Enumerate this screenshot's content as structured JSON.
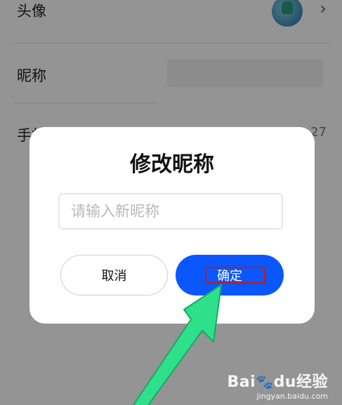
{
  "profile": {
    "rows": [
      {
        "label": "头像"
      },
      {
        "label": "昵称"
      },
      {
        "label": "手机号"
      }
    ],
    "phone_tail": "27",
    "chevron": "chevron-right-icon"
  },
  "dialog": {
    "title": "修改昵称",
    "input_placeholder": "请输入新昵称",
    "input_value": "",
    "cancel_label": "取消",
    "confirm_label": "确定"
  },
  "colors": {
    "confirm_button": "#0a57ff",
    "highlight_box": "#c31a1a",
    "arrow": "#2fe08a",
    "overlay": "rgba(0,0,0,0.42)"
  },
  "watermark": {
    "brand": "Bai",
    "brand2": "du",
    "brand3": "经验",
    "url": "jingyan.baidu.com"
  }
}
